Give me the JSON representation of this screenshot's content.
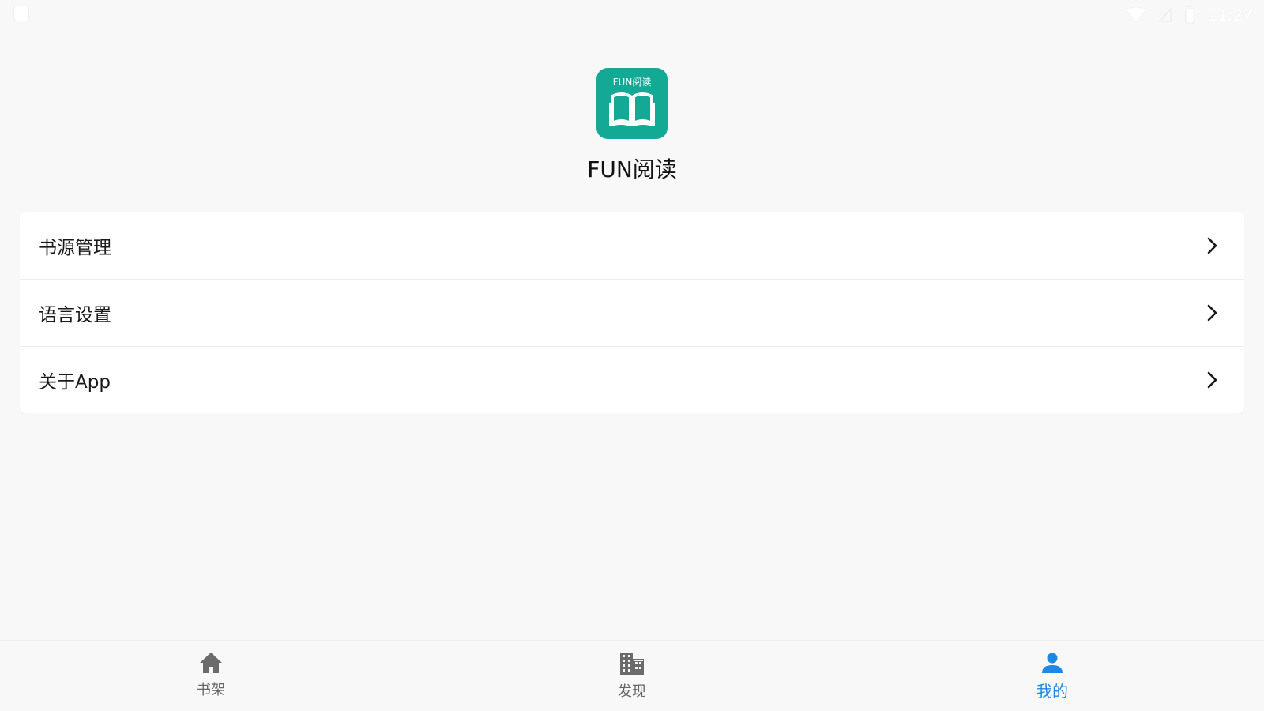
{
  "status_bar": {
    "time": "11:27",
    "icons": [
      "sd-card-icon",
      "wifi-icon",
      "signal-off-icon",
      "battery-icon"
    ]
  },
  "header": {
    "logo_text": "FUN阅读",
    "logo_icon": "open-book-icon",
    "app_name": "FUN阅读"
  },
  "menu": {
    "items": [
      {
        "label": "书源管理",
        "icon": "chevron-right-icon"
      },
      {
        "label": "语言设置",
        "icon": "chevron-right-icon"
      },
      {
        "label": "关于App",
        "icon": "chevron-right-icon"
      }
    ]
  },
  "bottom_nav": {
    "items": [
      {
        "label": "书架",
        "icon": "home-icon",
        "active": false
      },
      {
        "label": "发现",
        "icon": "building-icon",
        "active": false
      },
      {
        "label": "我的",
        "icon": "person-icon",
        "active": true
      }
    ]
  },
  "colors": {
    "background": "#f8f8f8",
    "card": "#ffffff",
    "logo": "#14a995",
    "active_nav": "#1e88e5",
    "inactive_nav": "#666666"
  }
}
